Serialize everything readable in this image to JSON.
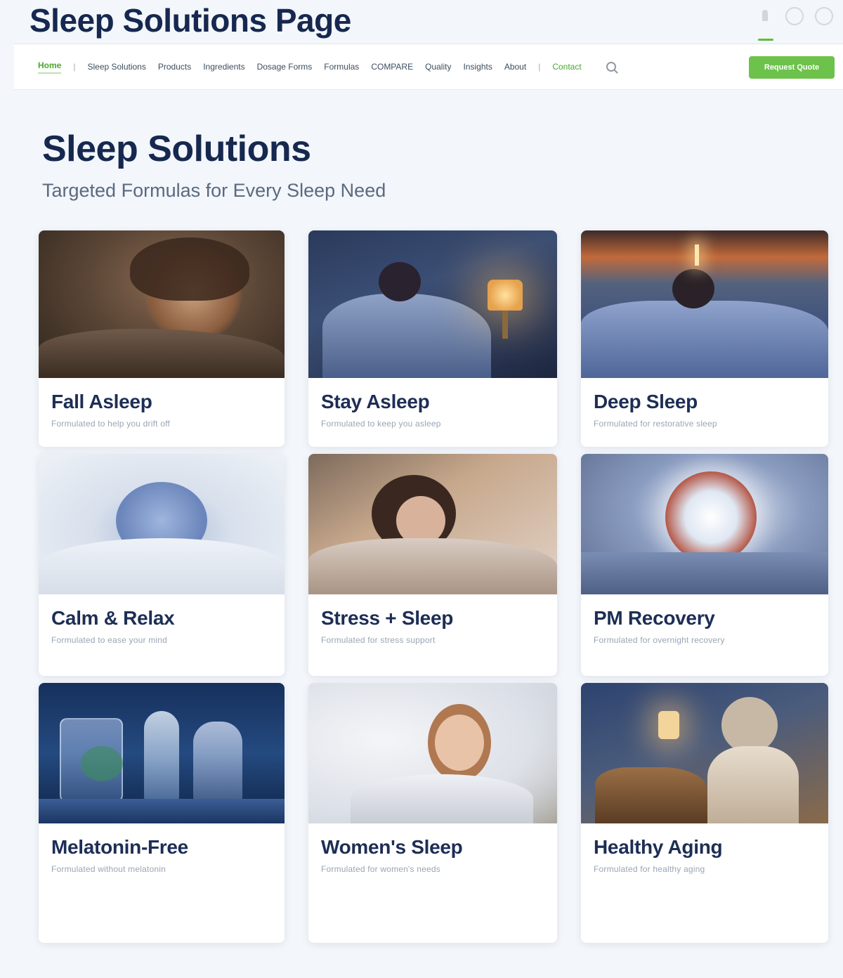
{
  "page": {
    "caption": "Sleep Solutions Page"
  },
  "nav": {
    "items": [
      {
        "label": "Home",
        "active": true
      },
      {
        "label": "Sleep Solutions"
      },
      {
        "label": "Products"
      },
      {
        "label": "Ingredients"
      },
      {
        "label": "Dosage Forms"
      },
      {
        "label": "Formulas"
      },
      {
        "label": "COMPARE"
      },
      {
        "label": "Quality"
      },
      {
        "label": "Insights"
      },
      {
        "label": "About"
      },
      {
        "label": "Contact",
        "highlight": true
      }
    ],
    "button_label": "Request Quote"
  },
  "hero": {
    "title": "Sleep Solutions",
    "subtitle": "Targeted Formulas for Every Sleep Need"
  },
  "cards": [
    {
      "title": "Fall Asleep",
      "desc": "Formulated to help you drift off",
      "scene": "woman-resting-warm-light"
    },
    {
      "title": "Stay Asleep",
      "desc": "Formulated to keep you asleep",
      "scene": "sleeper-bedside-lamp"
    },
    {
      "title": "Deep Sleep",
      "desc": "Formulated for restorative sleep",
      "scene": "sleeper-sunset-window"
    },
    {
      "title": "Calm & Relax",
      "desc": "Formulated to ease your mind",
      "scene": "soft-blankets-plush"
    },
    {
      "title": "Stress + Sleep",
      "desc": "Formulated for stress support",
      "scene": "woman-cuddling-in-bed"
    },
    {
      "title": "PM Recovery",
      "desc": "Formulated for overnight recovery",
      "scene": "glowing-orb-hands"
    },
    {
      "title": "Melatonin-Free",
      "desc": "Formulated without melatonin",
      "scene": "glass-bottles-botanicals"
    },
    {
      "title": "Women's Sleep",
      "desc": "Formulated for women's needs",
      "scene": "woman-on-pillow"
    },
    {
      "title": "Healthy Aging",
      "desc": "Formulated for healthy aging",
      "scene": "older-woman-lamplight"
    }
  ],
  "icons": [
    "bottle-icon",
    "circle-icon",
    "settings-icon",
    "search-icon"
  ],
  "colors": {
    "accent": "#6cc24a",
    "heading": "#16284f",
    "background": "#f3f6fa"
  }
}
